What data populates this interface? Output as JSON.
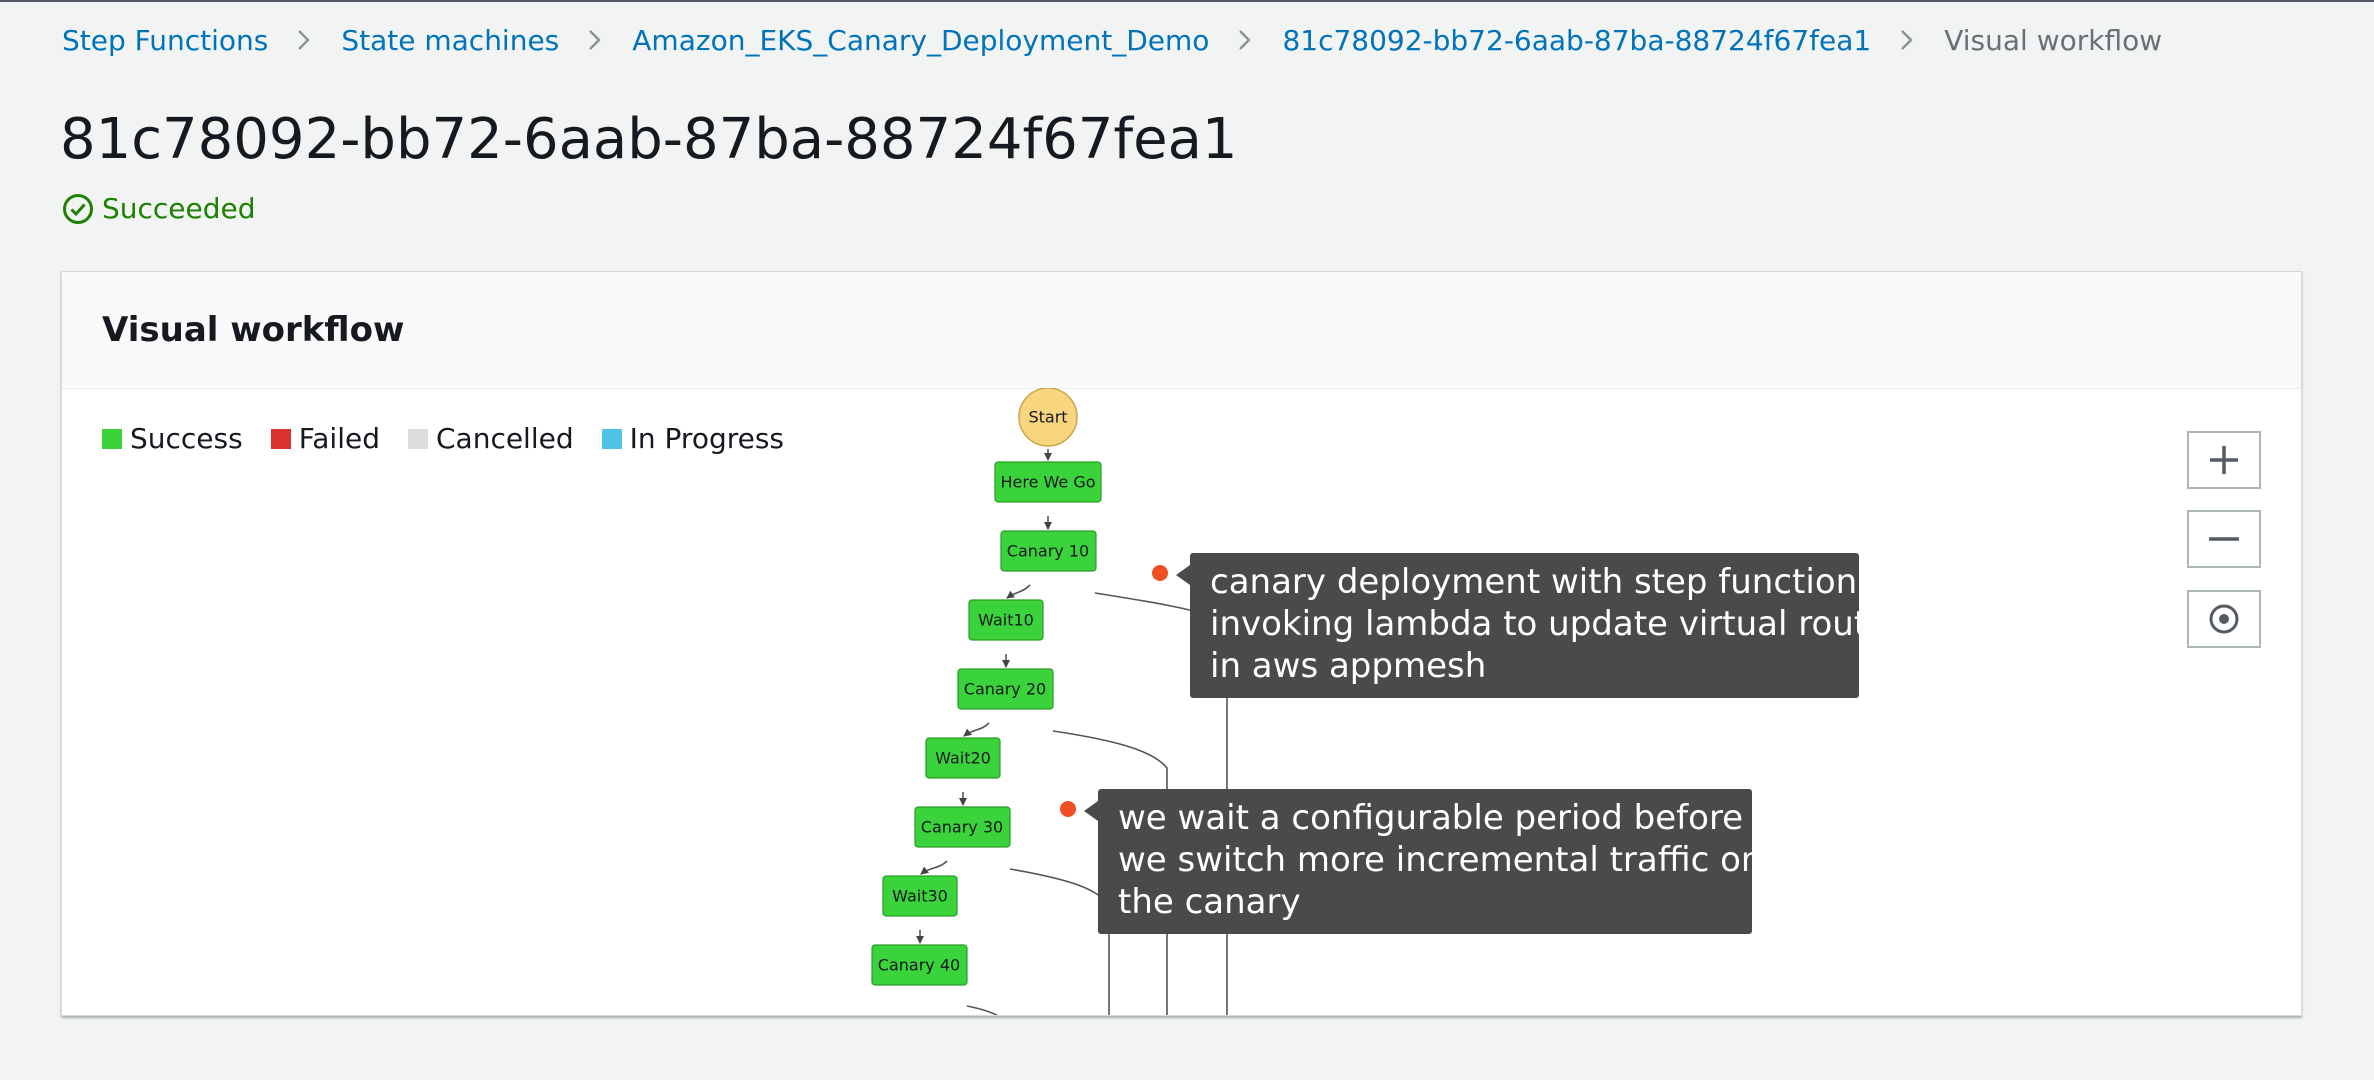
{
  "breadcrumb": {
    "items": [
      "Step Functions",
      "State machines",
      "Amazon_EKS_Canary_Deployment_Demo",
      "81c78092-bb72-6aab-87ba-88724f67fea1"
    ],
    "current": "Visual workflow"
  },
  "page": {
    "title": "81c78092-bb72-6aab-87ba-88724f67fea1",
    "status": "Succeeded"
  },
  "panel": {
    "title": "Visual workflow",
    "legend": [
      {
        "label": "Success",
        "color": "#3bd33b"
      },
      {
        "label": "Failed",
        "color": "#d9312b"
      },
      {
        "label": "Cancelled",
        "color": "#dddddd"
      },
      {
        "label": "In Progress",
        "color": "#4fc3e4"
      }
    ]
  },
  "workflow": {
    "nodes": [
      "Start",
      "Here We Go",
      "Canary 10",
      "Wait10",
      "Canary 20",
      "Wait20",
      "Canary 30",
      "Wait30",
      "Canary 40"
    ]
  },
  "controls": {
    "zoom_in": "zoom-in-icon",
    "zoom_out": "zoom-out-icon",
    "center": "center-icon"
  },
  "annotations": [
    [
      "canary deployment with step function",
      "invoking lambda to update virtual route",
      "in aws appmesh"
    ],
    [
      "we wait a configurable period before",
      "we switch more incremental traffic on",
      "the canary"
    ]
  ],
  "colors": {
    "link": "#0073bb",
    "success": "#1d8102",
    "node_success": "#3bd33b",
    "node_start": "#f8d57e"
  }
}
